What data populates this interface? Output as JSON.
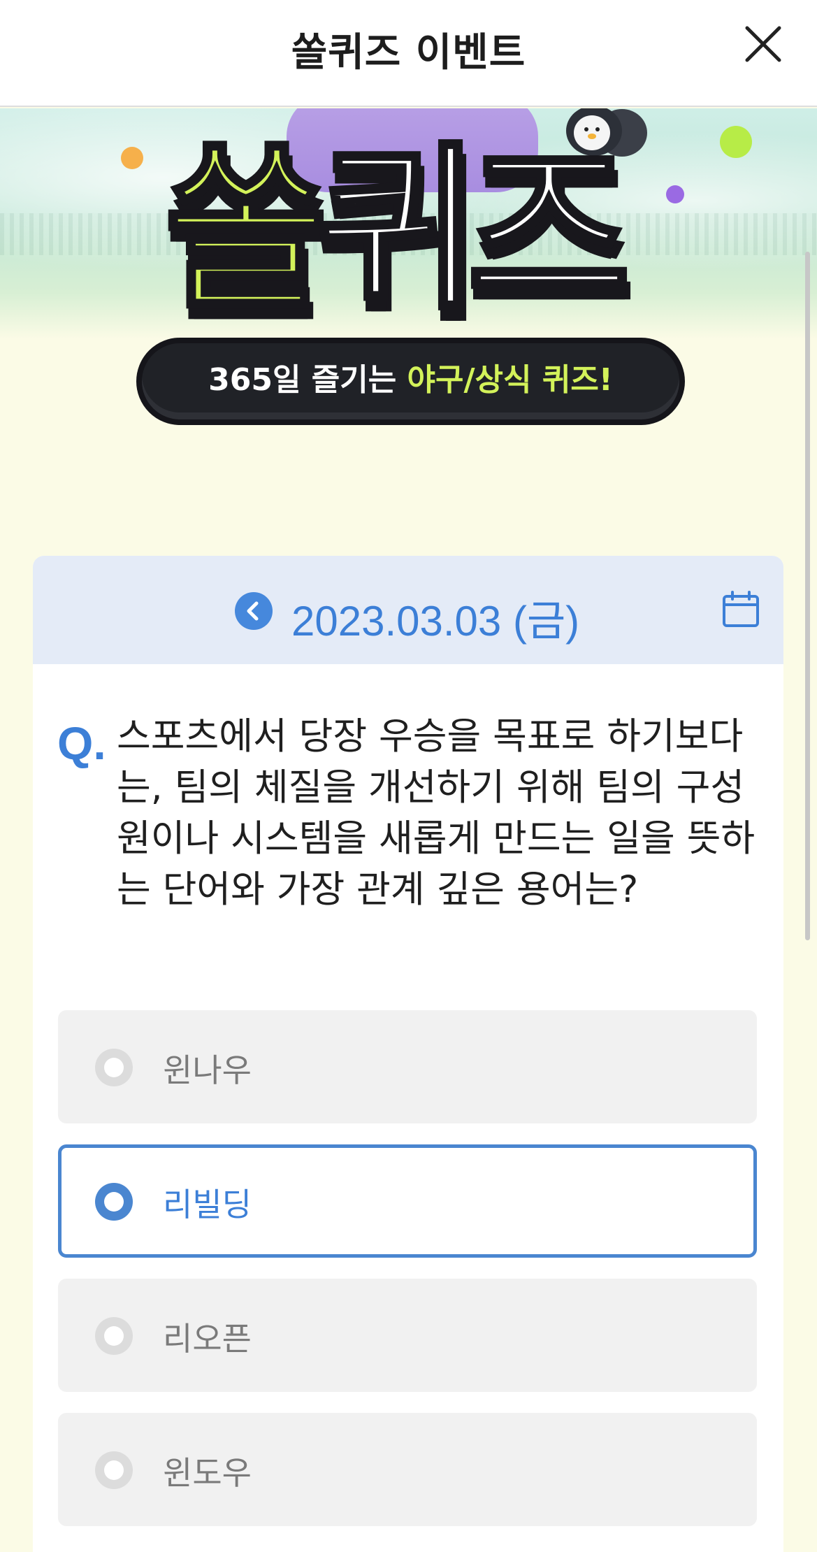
{
  "header": {
    "title": "쏠퀴즈 이벤트",
    "close_icon": "close-icon"
  },
  "banner": {
    "logo_part1": "쏠",
    "logo_part2": "퀴즈",
    "subtitle_prefix": "365일 즐기는 ",
    "subtitle_accent": "야구/상식 퀴즈!",
    "colors": {
      "lime": "#d3f25a",
      "dark": "#202227"
    }
  },
  "quiz": {
    "date": "2023.03.03 (금)",
    "prev_icon": "chevron-left-icon",
    "calendar_icon": "calendar-icon",
    "q_label": "Q.",
    "question": "스포츠에서 당장 우승을 목표로 하기보다는, 팀의 체질을 개선하기 위해 팀의 구성원이나 시스템을 새롭게 만드는 일을 뜻하는 단어와 가장 관계 깊은 용어는?",
    "options": [
      {
        "label": "윈나우",
        "selected": false
      },
      {
        "label": "리빌딩",
        "selected": true
      },
      {
        "label": "리오픈",
        "selected": false
      },
      {
        "label": "윈도우",
        "selected": false
      }
    ],
    "accent_color": "#3c7fd7"
  }
}
